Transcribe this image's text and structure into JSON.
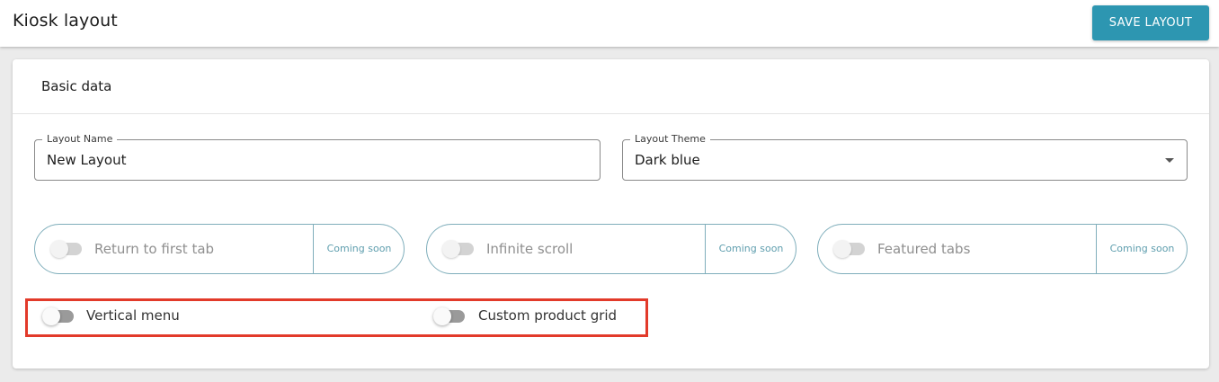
{
  "header": {
    "title": "Kiosk layout",
    "save_label": "SAVE LAYOUT"
  },
  "colors": {
    "accent": "#2d96b1",
    "pill_border": "#7faebb",
    "highlight": "#e23a2a"
  },
  "card": {
    "title": "Basic data",
    "layout_name": {
      "label": "Layout Name",
      "value": "New Layout"
    },
    "layout_theme": {
      "label": "Layout Theme",
      "value": "Dark blue"
    },
    "coming_soon_toggles": [
      {
        "label": "Return to first tab",
        "badge": "Coming soon",
        "enabled": false
      },
      {
        "label": "Infinite scroll",
        "badge": "Coming soon",
        "enabled": false
      },
      {
        "label": "Featured tabs",
        "badge": "Coming soon",
        "enabled": false
      }
    ],
    "toggles": [
      {
        "label": "Vertical menu",
        "on": false
      },
      {
        "label": "Custom product grid",
        "on": false
      }
    ]
  }
}
